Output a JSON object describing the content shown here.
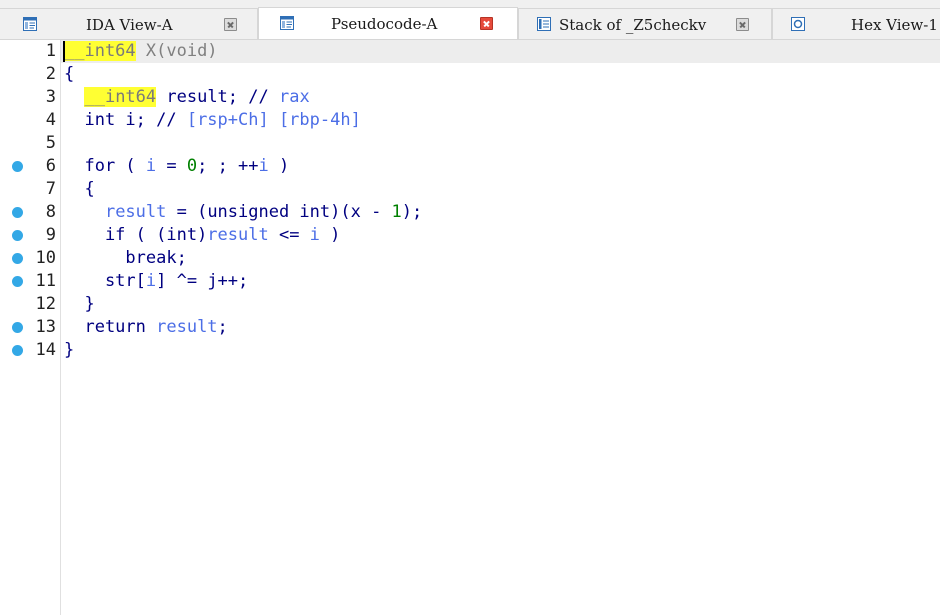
{
  "tabs": [
    {
      "label": "IDA View-A",
      "icon": "disassembly-view-icon",
      "active": false,
      "close_style": "gray"
    },
    {
      "label": "Pseudocode-A",
      "icon": "pseudocode-icon",
      "active": true,
      "close_style": "red"
    },
    {
      "label": "Stack of _Z5checkv",
      "icon": "stack-frame-icon",
      "active": false,
      "close_style": "gray"
    },
    {
      "label": "Hex View-1",
      "icon": "hex-view-icon",
      "active": false,
      "close_style": "gray"
    }
  ],
  "code": {
    "lines": [
      {
        "n": "1",
        "bp": false,
        "tokens": [
          [
            "__int64",
            "hl"
          ],
          [
            " X(void)",
            "gray"
          ]
        ]
      },
      {
        "n": "2",
        "bp": false,
        "tokens": [
          [
            "{",
            "plain"
          ]
        ]
      },
      {
        "n": "3",
        "bp": false,
        "tokens": [
          [
            "  ",
            "plain"
          ],
          [
            "__int64",
            "hl"
          ],
          [
            " result; // ",
            "plain"
          ],
          [
            "rax",
            "var"
          ]
        ]
      },
      {
        "n": "4",
        "bp": false,
        "tokens": [
          [
            "  int i; // ",
            "plain"
          ],
          [
            "[rsp+Ch] [rbp-4h]",
            "var"
          ]
        ]
      },
      {
        "n": "5",
        "bp": false,
        "tokens": []
      },
      {
        "n": "6",
        "bp": true,
        "tokens": [
          [
            "  for ( ",
            "plain"
          ],
          [
            "i",
            "var"
          ],
          [
            " = ",
            "plain"
          ],
          [
            "0",
            "num"
          ],
          [
            "; ; ++",
            "plain"
          ],
          [
            "i",
            "var"
          ],
          [
            " )",
            "plain"
          ]
        ]
      },
      {
        "n": "7",
        "bp": false,
        "tokens": [
          [
            "  {",
            "plain"
          ]
        ]
      },
      {
        "n": "8",
        "bp": true,
        "tokens": [
          [
            "    ",
            "plain"
          ],
          [
            "result",
            "var"
          ],
          [
            " = (unsigned int)(x - ",
            "plain"
          ],
          [
            "1",
            "num"
          ],
          [
            ");",
            "plain"
          ]
        ]
      },
      {
        "n": "9",
        "bp": true,
        "tokens": [
          [
            "    if ( (int)",
            "plain"
          ],
          [
            "result",
            "var"
          ],
          [
            " <= ",
            "plain"
          ],
          [
            "i",
            "var"
          ],
          [
            " )",
            "plain"
          ]
        ]
      },
      {
        "n": "10",
        "bp": true,
        "tokens": [
          [
            "      break;",
            "plain"
          ]
        ]
      },
      {
        "n": "11",
        "bp": true,
        "tokens": [
          [
            "    str[",
            "plain"
          ],
          [
            "i",
            "var"
          ],
          [
            "] ^= j++;",
            "plain"
          ]
        ]
      },
      {
        "n": "12",
        "bp": false,
        "tokens": [
          [
            "  }",
            "plain"
          ]
        ]
      },
      {
        "n": "13",
        "bp": true,
        "tokens": [
          [
            "  return ",
            "plain"
          ],
          [
            "result",
            "var"
          ],
          [
            ";",
            "plain"
          ]
        ]
      },
      {
        "n": "14",
        "bp": true,
        "tokens": [
          [
            "}",
            "plain"
          ]
        ]
      }
    ]
  },
  "colors": {
    "keyword": "#000080",
    "variable": "#4c6ee6",
    "number": "#008000",
    "highlight": "#ffff33",
    "breakpoint": "#33a8e6",
    "active_tab_close": "#e64a3b"
  }
}
